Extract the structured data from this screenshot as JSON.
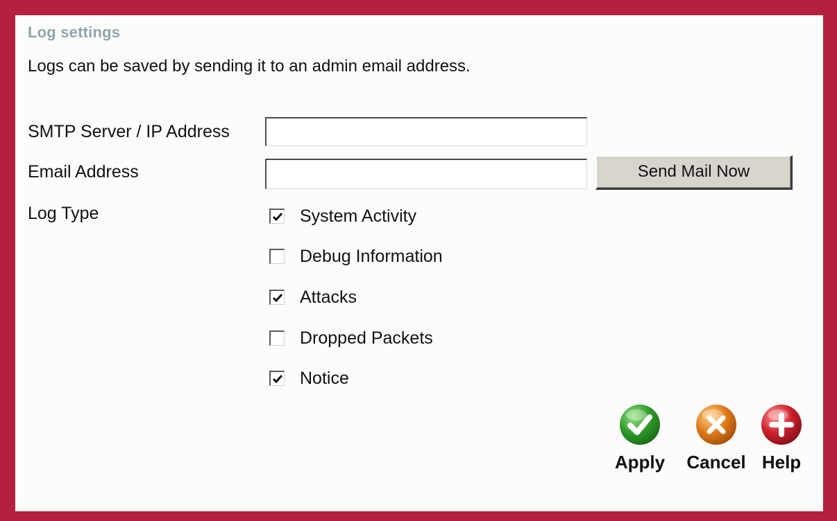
{
  "panel": {
    "title": "Log settings",
    "description": "Logs can be saved by sending it to an admin email address."
  },
  "form": {
    "smtp": {
      "label": "SMTP Server / IP Address",
      "value": ""
    },
    "email": {
      "label": "Email Address",
      "value": ""
    },
    "send_button_label": "Send Mail Now",
    "log_type": {
      "label": "Log Type",
      "options": [
        {
          "label": "System Activity",
          "checked": true
        },
        {
          "label": "Debug Information",
          "checked": false
        },
        {
          "label": "Attacks",
          "checked": true
        },
        {
          "label": "Dropped Packets",
          "checked": false
        },
        {
          "label": "Notice",
          "checked": true
        }
      ]
    }
  },
  "actions": {
    "apply": {
      "label": "Apply",
      "icon": "checkmark-icon",
      "color": "#2f9b2a"
    },
    "cancel": {
      "label": "Cancel",
      "icon": "x-icon",
      "color": "#e07a18"
    },
    "help": {
      "label": "Help",
      "icon": "plus-icon",
      "color": "#cc1f2b"
    }
  },
  "colors": {
    "frame": "#b3213f",
    "title": "#8fa6ad",
    "button_face": "#d7d4cc"
  }
}
